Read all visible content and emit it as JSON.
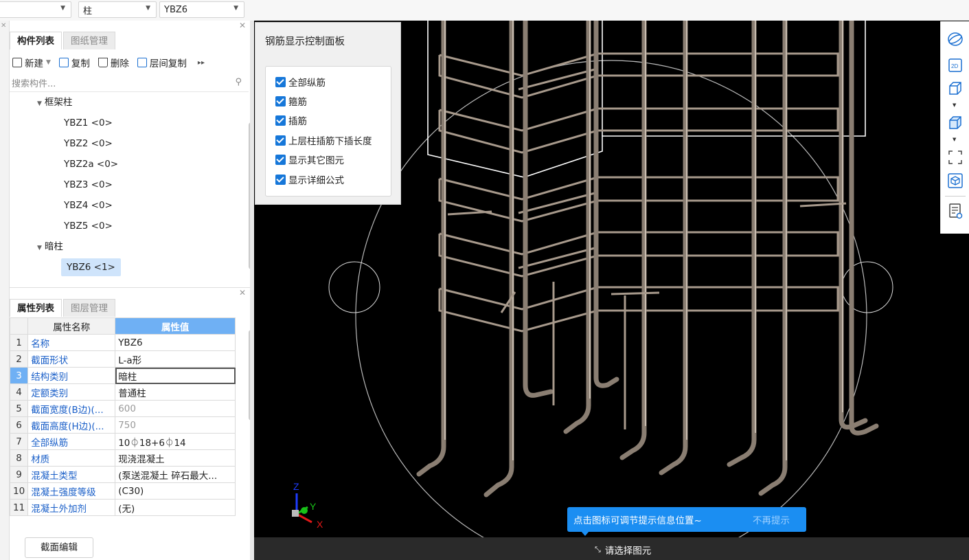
{
  "top_selectors": {
    "category": "柱",
    "component": "YBZ6"
  },
  "component_panel": {
    "tabs": [
      "构件列表",
      "图纸管理"
    ],
    "toolbar": {
      "new": "新建",
      "copy": "复制",
      "delete": "删除",
      "floor_copy": "层间复制"
    },
    "search_placeholder": "搜索构件...",
    "tree": [
      {
        "label": "框架柱",
        "children": [
          "YBZ1 <0>",
          "YBZ2 <0>",
          "YBZ2a <0>",
          "YBZ3 <0>",
          "YBZ4 <0>",
          "YBZ5 <0>"
        ]
      },
      {
        "label": "暗柱",
        "children": [
          "YBZ6 <1>"
        ]
      }
    ]
  },
  "property_panel": {
    "tabs": [
      "属性列表",
      "图层管理"
    ],
    "headers": [
      "属性名称",
      "属性值"
    ],
    "rows": [
      {
        "num": "1",
        "name": "名称",
        "value": "YBZ6"
      },
      {
        "num": "2",
        "name": "截面形状",
        "value": "L-a形"
      },
      {
        "num": "3",
        "name": "结构类别",
        "value": "暗柱"
      },
      {
        "num": "4",
        "name": "定额类别",
        "value": "普通柱"
      },
      {
        "num": "5",
        "name": "截面宽度(B边)(...",
        "value": "600"
      },
      {
        "num": "6",
        "name": "截面高度(H边)(...",
        "value": "750"
      },
      {
        "num": "7",
        "name": "全部纵筋",
        "value": "10⏀18+6⏀14"
      },
      {
        "num": "8",
        "name": "材质",
        "value": "现浇混凝土"
      },
      {
        "num": "9",
        "name": "混凝土类型",
        "value": "(泵送混凝土 碎石最大..."
      },
      {
        "num": "10",
        "name": "混凝土强度等级",
        "value": "(C30)"
      },
      {
        "num": "11",
        "name": "混凝土外加剂",
        "value": "(无)"
      }
    ],
    "section_edit_button": "截面编辑"
  },
  "rebar_control": {
    "title": "钢筋显示控制面板",
    "options": [
      "全部纵筋",
      "箍筋",
      "插筋",
      "上层柱插筋下插长度",
      "显示其它图元",
      "显示详细公式"
    ]
  },
  "right_toolbar_icons": [
    "orbit-icon",
    "2d-view-icon",
    "3d-box-icon",
    "3d-solid-icon",
    "fullscreen-icon",
    "view-cube-icon",
    "layer-display-icon"
  ],
  "tip": {
    "text": "点击图标可调节提示信息位置~",
    "dismiss": "不再提示"
  },
  "status": {
    "text": "请选择图元"
  },
  "axis_labels": {
    "x": "X",
    "y": "Y",
    "z": "Z"
  }
}
